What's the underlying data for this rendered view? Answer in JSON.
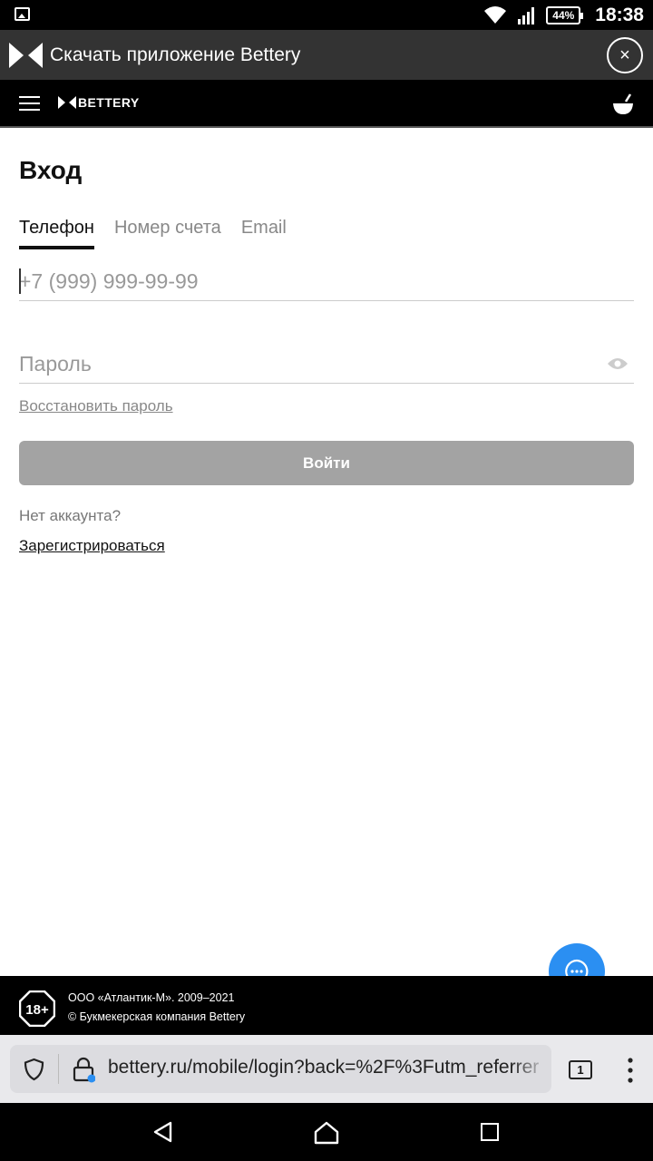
{
  "status_bar": {
    "battery": "44%",
    "time": "18:38"
  },
  "app_banner": {
    "text": "Скачать приложение Bettery",
    "close": "×"
  },
  "header": {
    "brand": "BETTERY"
  },
  "login": {
    "title": "Вход",
    "tabs": [
      {
        "label": "Телефон",
        "active": true
      },
      {
        "label": "Номер счета",
        "active": false
      },
      {
        "label": "Email",
        "active": false
      }
    ],
    "phone_placeholder": "+7 (999) 999-99-99",
    "password_placeholder": "Пароль",
    "restore_link": "Восстановить пароль",
    "submit_label": "Войти",
    "no_account": "Нет аккаунта?",
    "register_link": "Зарегистрироваться"
  },
  "footer": {
    "age": "18+",
    "line1": "ООО «Атлантик-М». 2009–2021",
    "line2": "© Букмекерская компания Bettery"
  },
  "browser": {
    "url": "bettery.ru/mobile/login?back=%2F%3Futm_referrer",
    "tab_count": "1"
  },
  "colors": {
    "accent_blue": "#2b8ff2",
    "button_gray": "#a3a3a3"
  }
}
